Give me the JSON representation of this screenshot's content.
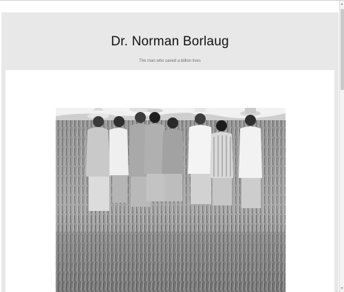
{
  "header": {
    "title": "Dr. Norman Borlaug",
    "subtitle": "The man who saved a billion lives"
  },
  "image": {
    "subject": "black-and-white photograph of men standing in a wheat field"
  },
  "scrollbar": {
    "up_arrow": "▲",
    "down_arrow": "▼"
  },
  "colors": {
    "page_background": "#e8e8e8",
    "card_background": "#ffffff",
    "title_text": "#111111",
    "subtitle_text": "#707070"
  }
}
